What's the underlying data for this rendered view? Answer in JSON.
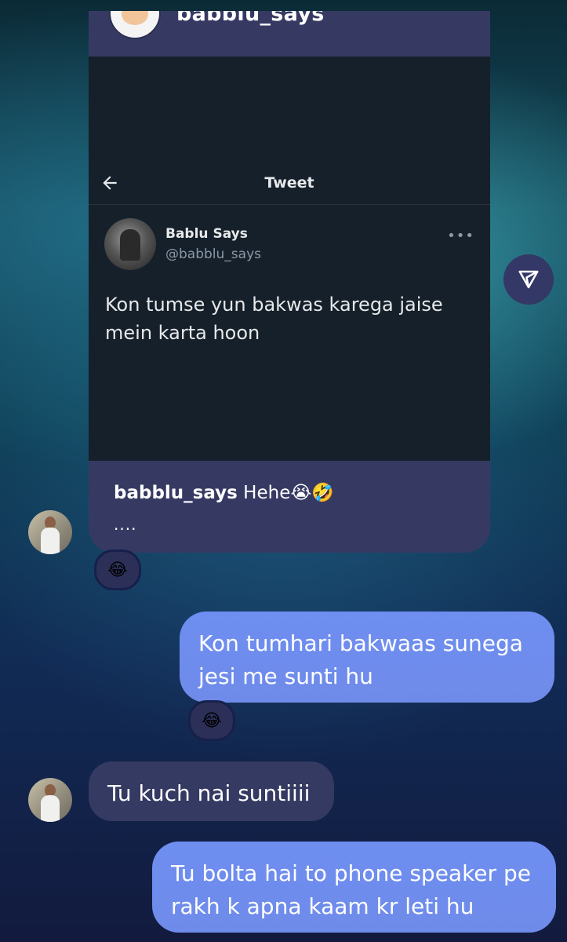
{
  "shared_post": {
    "username": "babblu_says",
    "tweet_screen": {
      "title": "Tweet",
      "author_name": "Bablu Says",
      "author_handle": "@babblu_says",
      "more_label": "•••",
      "text": "Kon tumse yun bakwas karega jaise mein karta hoon"
    },
    "caption_user": "babblu_says",
    "caption_text": "Hehe😭🤣",
    "caption_more": "...."
  },
  "reactions": {
    "first": "😂",
    "second": "😂"
  },
  "messages": [
    {
      "from": "me",
      "text": "Kon tumhari bakwaas sunega jesi me sunti hu"
    },
    {
      "from": "them",
      "text": "Tu kuch nai suntiiii"
    },
    {
      "from": "me",
      "text": "Tu bolta hai to phone speaker pe rakh k apna kaam kr leti hu"
    }
  ],
  "icons": {
    "share": "send-icon",
    "back": "back-arrow-icon"
  },
  "colors": {
    "outgoing_bubble": "#6e8ef0",
    "incoming_bubble": "#343a61",
    "tweet_bg": "#15202b"
  }
}
